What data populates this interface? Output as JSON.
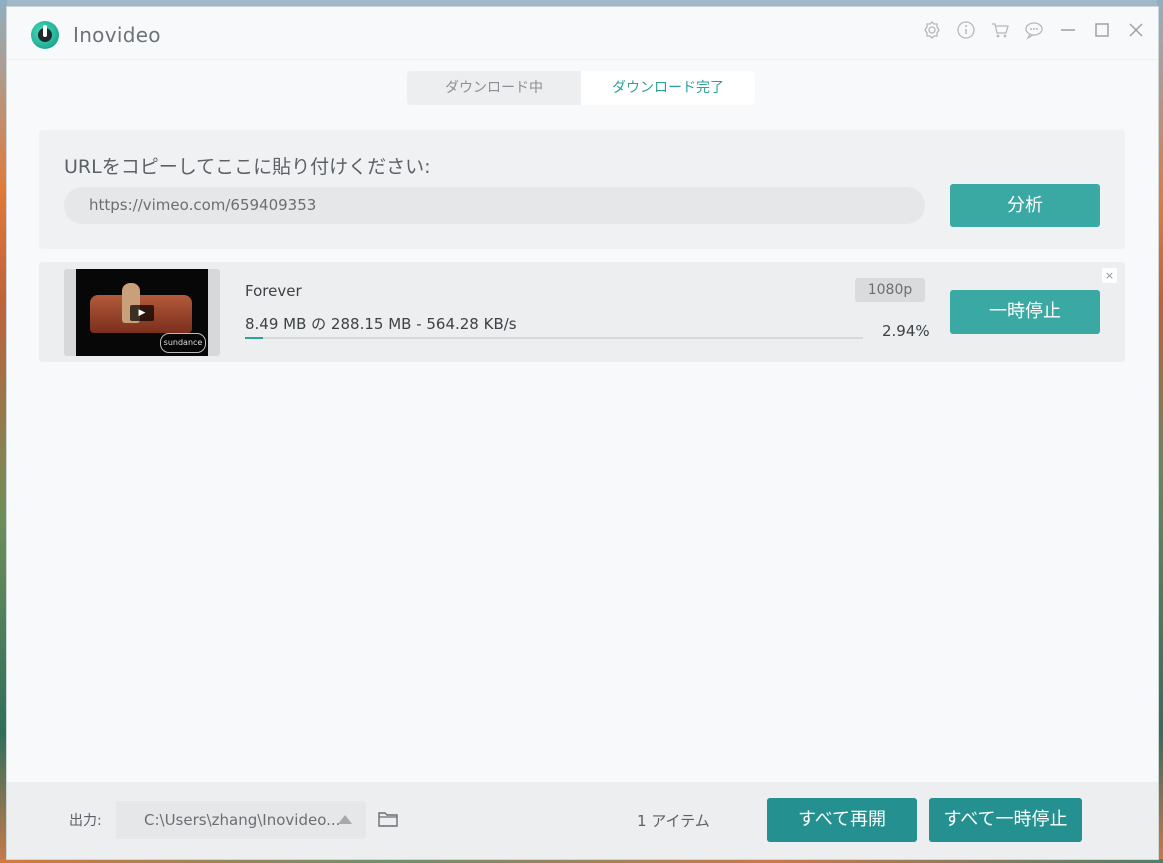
{
  "app": {
    "title": "Inovideo"
  },
  "titlebar": {
    "icons": [
      "settings-icon",
      "info-icon",
      "cart-icon",
      "feedback-icon",
      "minimize-icon",
      "maximize-icon",
      "close-icon"
    ]
  },
  "tabs": [
    {
      "label": "ダウンロード中",
      "active": false
    },
    {
      "label": "ダウンロード完了",
      "active": true
    }
  ],
  "url_panel": {
    "label": "URLをコピーしてここに貼り付けください:",
    "input_value": "https://vimeo.com/659409353",
    "analyze_label": "分析"
  },
  "download_item": {
    "title": "Forever",
    "resolution": "1080p",
    "progress_text": "8.49 MB の 288.15 MB - 564.28 KB/s",
    "percent_text": "2.94%",
    "progress_fraction": 0.0294,
    "pause_label": "一時停止",
    "close_label": "×",
    "thumbnail": {
      "play_glyph": "▶",
      "brand_text": "sundance"
    }
  },
  "footer": {
    "output_label": "出力:",
    "output_path": "C:\\Users\\zhang\\Inovideo...",
    "item_count": "1 アイテム",
    "resume_all_label": "すべて再開",
    "pause_all_label": "すべて一時停止"
  },
  "colors": {
    "accent": "#3aa9a4",
    "accent_dark": "#249090",
    "tab_active_text": "#2ea19a"
  }
}
